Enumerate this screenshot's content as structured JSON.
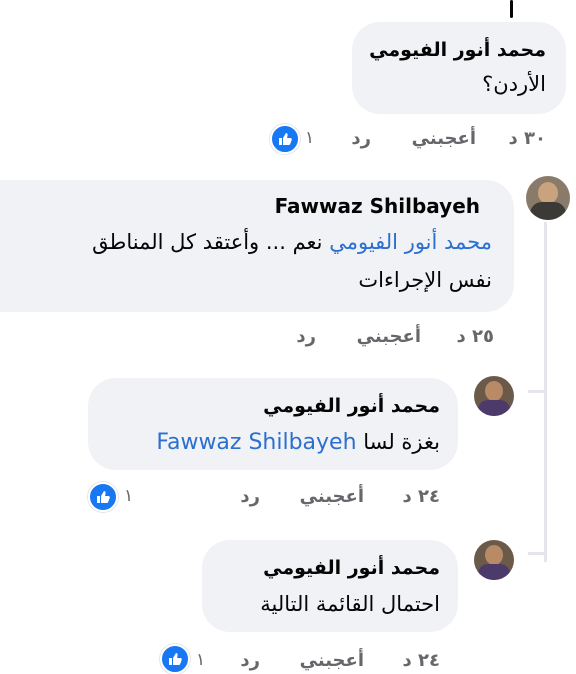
{
  "comments": [
    {
      "author": "محمد أنور الفيومي",
      "text": "الأردن؟",
      "time": "٣٠ د",
      "like_label": "أعجبني",
      "reply_label": "رد",
      "reaction_count": "١"
    },
    {
      "author": "Fawwaz Shilbayeh",
      "mention": "محمد أنور الفيومي",
      "text_line1": "نعم ... وأعتقد كل المناطق",
      "text_line2": "نفس الإجراءات",
      "time": "٢٥ د",
      "like_label": "أعجبني",
      "reply_label": "رد"
    },
    {
      "author": "محمد أنور الفيومي",
      "text": "بغزة لسا",
      "mention": "Fawwaz Shilbayeh",
      "time": "٢٤ د",
      "like_label": "أعجبني",
      "reply_label": "رد",
      "reaction_count": "١"
    },
    {
      "author": "محمد أنور الفيومي",
      "text": "احتمال القائمة التالية",
      "time": "٢٤ د",
      "like_label": "أعجبني",
      "reply_label": "رد",
      "reaction_count": "١"
    }
  ],
  "icons": {
    "reaction": "thumbs-up-icon",
    "avatar": "avatar"
  },
  "colors": {
    "bubble": "#f0f2f5",
    "mention": "#2b6fd0",
    "meta": "#65676b",
    "reaction": "#1877f2"
  }
}
